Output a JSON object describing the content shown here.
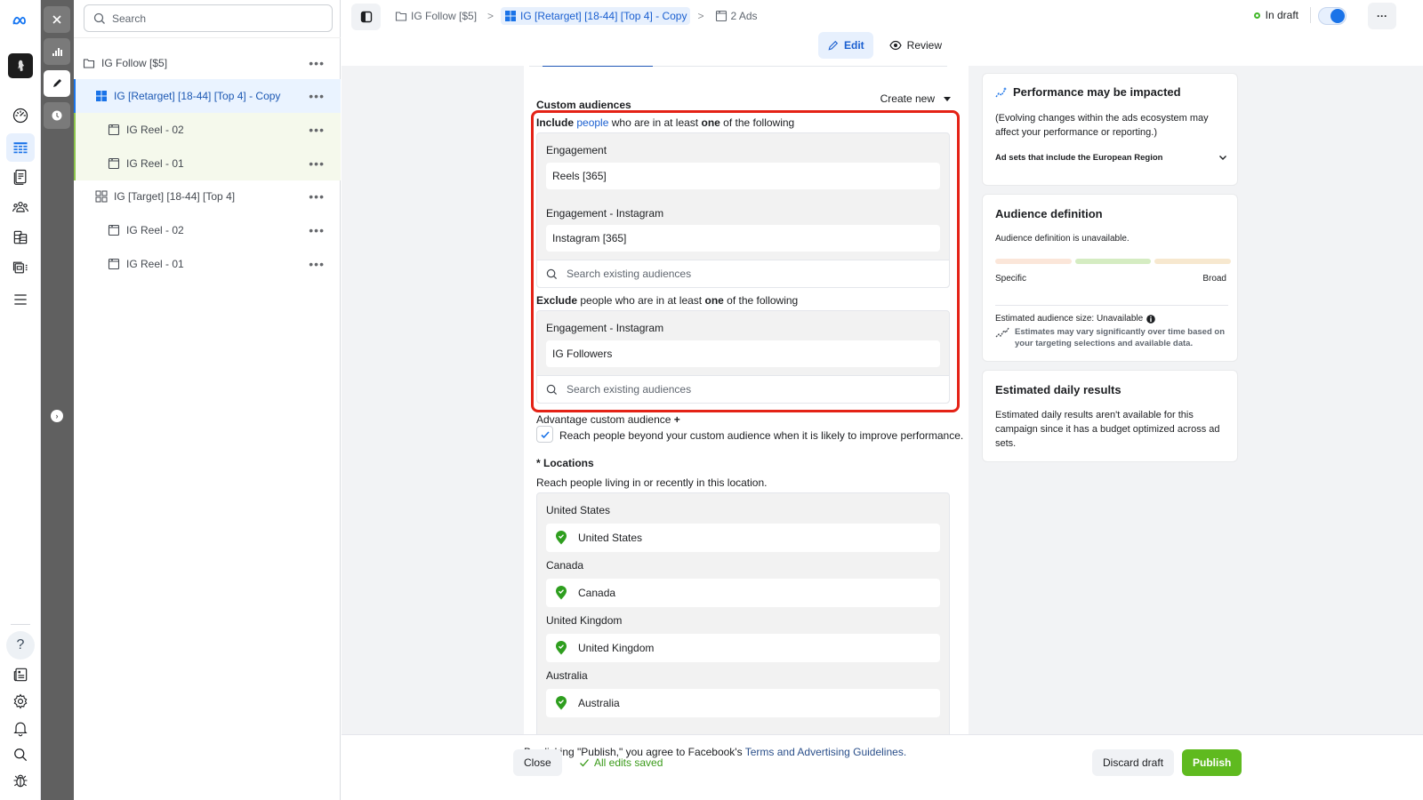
{
  "rail": {
    "icons": [
      "meta-logo-icon",
      "account-avatar",
      "dashboard-gauge-icon",
      "campaigns-table-icon",
      "pages-icon",
      "audiences-icon",
      "billing-icon",
      "catalog-icon",
      "menu-icon",
      "help-icon",
      "news-icon",
      "settings-icon",
      "notifications-icon",
      "search-icon",
      "bug-report-icon"
    ],
    "help_label": "?"
  },
  "strip": {
    "expand_label": "›"
  },
  "tree": {
    "search_placeholder": "Search",
    "rows": [
      {
        "label": "IG Follow [$5]",
        "type": "campaign"
      },
      {
        "label": "IG [Retarget] [18-44] [Top 4] - Copy",
        "type": "adset",
        "selected": true
      },
      {
        "label": "IG Reel - 02",
        "type": "ad"
      },
      {
        "label": "IG Reel - 01",
        "type": "ad"
      },
      {
        "label": "IG [Target] [18-44] [Top 4]",
        "type": "adset"
      },
      {
        "label": "IG Reel - 02",
        "type": "ad"
      },
      {
        "label": "IG Reel - 01",
        "type": "ad"
      }
    ],
    "more_label": "•••"
  },
  "header": {
    "breadcrumbs": [
      {
        "label": "IG Follow [$5]"
      },
      {
        "label": "IG [Retarget] [18-44] [Top 4] - Copy"
      },
      {
        "label": "2 Ads"
      }
    ],
    "status": "In draft",
    "toggle_on": true,
    "more_label": "···",
    "modes": [
      {
        "label": "Edit",
        "active": true
      },
      {
        "label": "Review",
        "active": false
      }
    ]
  },
  "form": {
    "custom_audiences_title": "Custom audiences",
    "create_new_label": "Create new",
    "include": {
      "verb": "Include",
      "link": "people",
      "mid": "who are in at least",
      "emph": "one",
      "tail": "of the following",
      "groups": [
        {
          "label": "Engagement",
          "value": "Reels [365]"
        },
        {
          "label": "Engagement - Instagram",
          "value": "Instagram [365]"
        }
      ],
      "search_placeholder": "Search existing audiences"
    },
    "exclude": {
      "verb": "Exclude",
      "mid": "people who are in at least",
      "emph": "one",
      "tail": "of the following",
      "groups": [
        {
          "label": "Engagement - Instagram",
          "value": "IG Followers"
        }
      ],
      "search_placeholder": "Search existing audiences"
    },
    "advantage": {
      "title": "Advantage custom audience",
      "title_suffix": "+",
      "checkbox_label": "Reach people beyond your custom audience when it is likely to improve performance.",
      "checked": true
    },
    "locations": {
      "title": "* Locations",
      "subtitle": "Reach people living in or recently in this location.",
      "items": [
        {
          "label": "United States",
          "value": "United States"
        },
        {
          "label": "Canada",
          "value": "Canada"
        },
        {
          "label": "United Kingdom",
          "value": "United Kingdom"
        },
        {
          "label": "Australia",
          "value": "Australia"
        }
      ]
    }
  },
  "right": {
    "performance": {
      "title": "Performance may be impacted",
      "body": "(Evolving changes within the ads ecosystem may affect your performance or reporting.)",
      "expander": "Ad sets that include the European Region"
    },
    "audience_definition": {
      "title": "Audience definition",
      "body": "Audience definition is unavailable.",
      "left_label": "Specific",
      "right_label": "Broad",
      "size_label": "Estimated audience size: Unavailable",
      "note": "Estimates may vary significantly over time based on your targeting selections and available data.",
      "colors": {
        "specific": "#fbe6d9",
        "middle": "#d5ecc2",
        "broad": "#f7e8cf"
      }
    },
    "daily_results": {
      "title": "Estimated daily results",
      "body": "Estimated daily results aren't available for this campaign since it has a budget optimized across ad sets."
    }
  },
  "footer": {
    "terms_prefix": "By clicking \"Publish,\" you agree to Facebook's",
    "terms_link": "Terms and Advertising Guidelines.",
    "close_label": "Close",
    "saved_label": "All edits saved",
    "discard_label": "Discard draft",
    "publish_label": "Publish",
    "colors": {
      "publish": "#5fba1f",
      "saved": "#3a9a19"
    }
  }
}
